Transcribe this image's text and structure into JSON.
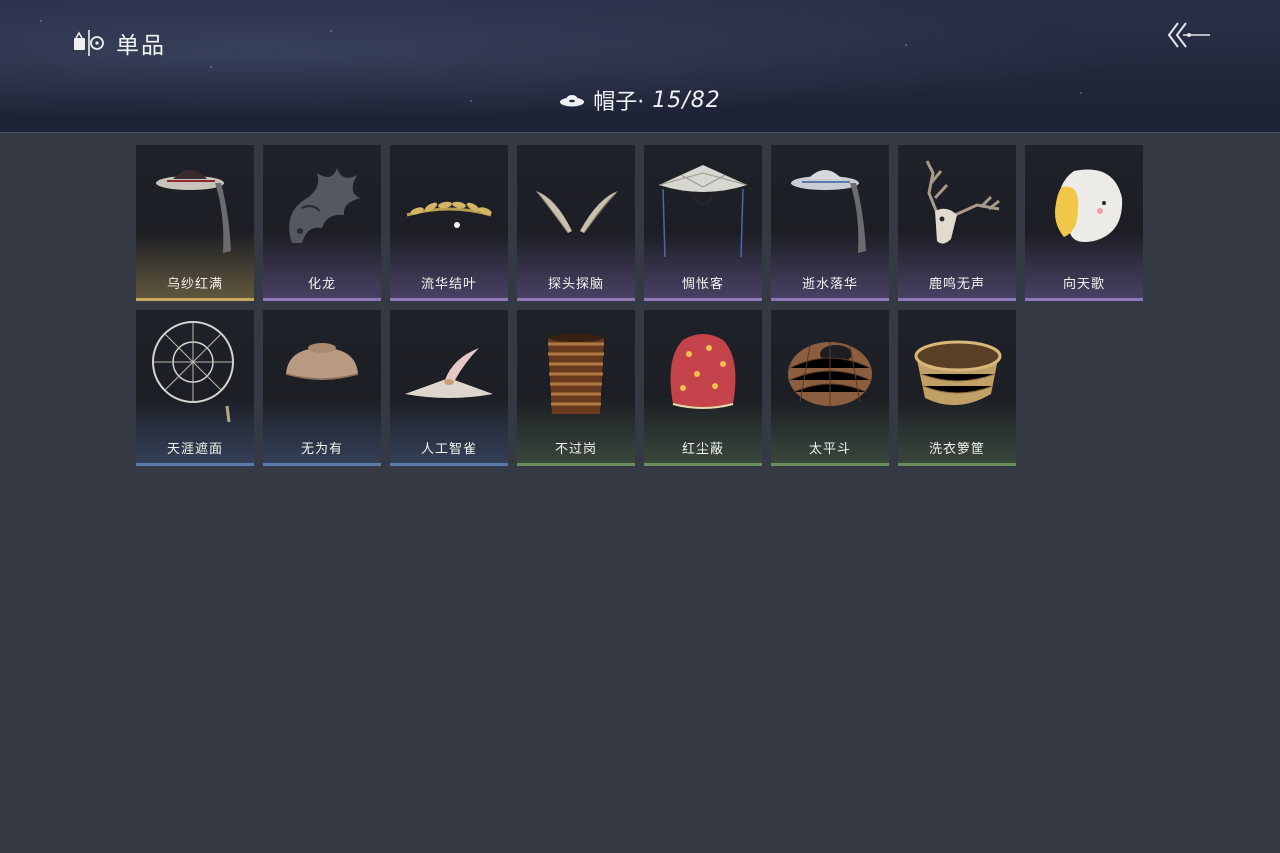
{
  "header": {
    "title": "单品",
    "back_icon": "back-arrow-icon",
    "brand_icon": "collection-icon"
  },
  "category": {
    "icon": "hat-icon",
    "label": "帽子·",
    "count": "15/82"
  },
  "rarity_colors": {
    "gold": "#c8a85e",
    "purple": "#8d79b8",
    "blue": "#5a7bab",
    "green": "#6b8f5b"
  },
  "items": [
    {
      "name": "乌纱红满",
      "rarity": "gold",
      "icon": "veiled-hat-icon"
    },
    {
      "name": "化龙",
      "rarity": "purple",
      "icon": "dragon-icon"
    },
    {
      "name": "流华结叶",
      "rarity": "purple",
      "icon": "laurel-wreath-icon"
    },
    {
      "name": "探头探脑",
      "rarity": "purple",
      "icon": "feather-antennae-icon"
    },
    {
      "name": "惆怅客",
      "rarity": "purple",
      "icon": "bamboo-hat-icon"
    },
    {
      "name": "逝水落华",
      "rarity": "purple",
      "icon": "veiled-hat-icon"
    },
    {
      "name": "鹿鸣无声",
      "rarity": "purple",
      "icon": "deer-skull-icon"
    },
    {
      "name": "向天歌",
      "rarity": "purple",
      "icon": "goose-hood-icon"
    },
    {
      "name": "天涯遮面",
      "rarity": "blue",
      "icon": "wire-hat-icon"
    },
    {
      "name": "无为有",
      "rarity": "blue",
      "icon": "bowl-hat-icon"
    },
    {
      "name": "人工智雀",
      "rarity": "blue",
      "icon": "bird-hat-icon"
    },
    {
      "name": "不过岗",
      "rarity": "green",
      "icon": "stacked-bowls-icon"
    },
    {
      "name": "红尘蔽",
      "rarity": "green",
      "icon": "red-hood-icon"
    },
    {
      "name": "太平斗",
      "rarity": "green",
      "icon": "woven-basket-hat-icon"
    },
    {
      "name": "洗衣箩筐",
      "rarity": "green",
      "icon": "laundry-basket-icon"
    }
  ]
}
